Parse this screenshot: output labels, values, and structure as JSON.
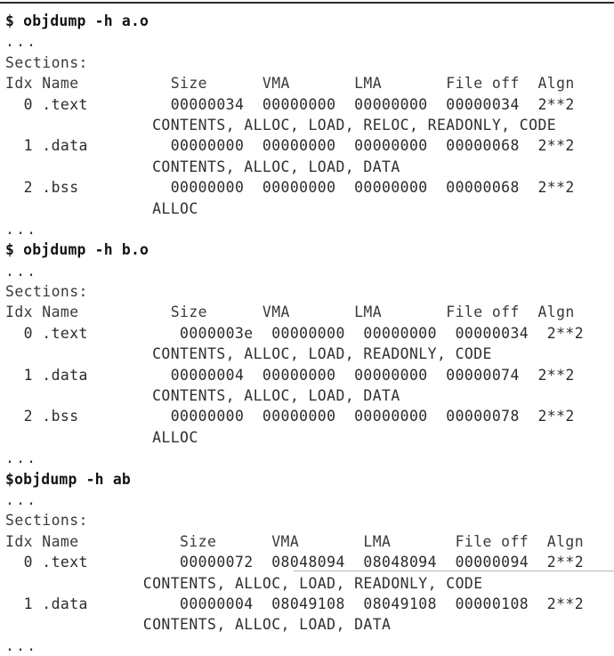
{
  "figure": {
    "kind": "terminal-transcript",
    "description": "objdump -h section header listings for a.o, b.o and linked executable ab",
    "ellipsis": "...",
    "text_color": "#2b2b2b",
    "background_color": "#ffffff",
    "rule_color": "#2a2a2a"
  },
  "columns": {
    "idx": "Idx",
    "name": "Name",
    "size": "Size",
    "vma": "VMA",
    "lma": "LMA",
    "file_off": "File off",
    "algn": "Algn",
    "header_line": "Idx Name          Size      VMA       LMA       File off  Algn",
    "sections_label": "Sections:"
  },
  "blocks": [
    {
      "id": "a-o",
      "command": "$ objdump -h a.o",
      "lead_ellipsis": null,
      "sections_label": "Sections:",
      "header_line": "Idx Name          Size      VMA       LMA       File off  Algn",
      "rows": [
        {
          "idx": "0",
          "name": ".text",
          "size": "00000034",
          "vma": "00000000",
          "lma": "00000000",
          "file_off": "00000034",
          "algn": "2**2",
          "row_line": "  0 .text         00000034  00000000  00000000  00000034  2**2",
          "flags": "CONTENTS, ALLOC, LOAD, RELOC, READONLY, CODE",
          "flags_line": "                CONTENTS, ALLOC, LOAD, RELOC, READONLY, CODE"
        },
        {
          "idx": "1",
          "name": ".data",
          "size": "00000000",
          "vma": "00000000",
          "lma": "00000000",
          "file_off": "00000068",
          "algn": "2**2",
          "row_line": "  1 .data         00000000  00000000  00000000  00000068  2**2",
          "flags": "CONTENTS, ALLOC, LOAD, DATA",
          "flags_line": "                CONTENTS, ALLOC, LOAD, DATA"
        },
        {
          "idx": "2",
          "name": ".bss",
          "size": "00000000",
          "vma": "00000000",
          "lma": "00000000",
          "file_off": "00000068",
          "algn": "2**2",
          "row_line": "  2 .bss          00000000  00000000  00000000  00000068  2**2",
          "flags": "ALLOC",
          "flags_line": "                ALLOC"
        }
      ],
      "trail_ellipsis": "..."
    },
    {
      "id": "b-o",
      "command": "$ objdump -h b.o",
      "lead_ellipsis": "...",
      "sections_label": "Sections:",
      "header_line": "Idx Name          Size      VMA       LMA       File off  Algn",
      "rows": [
        {
          "idx": "0",
          "name": ".text",
          "size": "0000003e",
          "vma": "00000000",
          "lma": "00000000",
          "file_off": "00000034",
          "algn": "2**2",
          "row_line": "  0 .text          0000003e  00000000  00000000  00000034  2**2",
          "flags": "CONTENTS, ALLOC, LOAD, READONLY, CODE",
          "flags_line": "                CONTENTS, ALLOC, LOAD, READONLY, CODE"
        },
        {
          "idx": "1",
          "name": ".data",
          "size": "00000004",
          "vma": "00000000",
          "lma": "00000000",
          "file_off": "00000074",
          "algn": "2**2",
          "row_line": "  1 .data         00000004  00000000  00000000  00000074  2**2",
          "flags": "CONTENTS, ALLOC, LOAD, DATA",
          "flags_line": "                CONTENTS, ALLOC, LOAD, DATA"
        },
        {
          "idx": "2",
          "name": ".bss",
          "size": "00000000",
          "vma": "00000000",
          "lma": "00000000",
          "file_off": "00000078",
          "algn": "2**2",
          "row_line": "  2 .bss          00000000  00000000  00000000  00000078  2**2",
          "flags": "ALLOC",
          "flags_line": "                ALLOC"
        }
      ],
      "trail_ellipsis": "..."
    },
    {
      "id": "ab",
      "command": "$objdump -h ab",
      "lead_ellipsis": "...",
      "sections_label": "Sections:",
      "header_line": "Idx Name           Size      VMA       LMA       File off  Algn",
      "rows": [
        {
          "idx": "0",
          "name": ".text",
          "size": "00000072",
          "vma": "08048094",
          "lma": "08048094",
          "file_off": "00000094",
          "algn": "2**2",
          "row_line": "  0 .text          00000072  08048094  08048094  00000094  2**2",
          "flags": "CONTENTS, ALLOC, LOAD, READONLY, CODE",
          "flags_line": "                CONTENTS, ALLOC, LOAD, READONLY, CODE"
        },
        {
          "idx": "1",
          "name": ".data",
          "size": "00000004",
          "vma": "08049108",
          "lma": "08049108",
          "file_off": "00000108",
          "algn": "2**2",
          "row_line": "  1 .data          00000004  08049108  08049108  00000108  2**2",
          "flags": "CONTENTS, ALLOC, LOAD, DATA",
          "flags_line": "                CONTENTS, ALLOC, LOAD, DATA"
        }
      ],
      "trail_ellipsis": "..."
    }
  ],
  "rendered_lines": [
    {
      "key": "l01",
      "text": "$ objdump -h a.o",
      "style": "cmd"
    },
    {
      "key": "l02",
      "text": "...",
      "style": "ellipsis"
    },
    {
      "key": "l03",
      "text": "Sections:",
      "style": "label"
    },
    {
      "key": "l04",
      "text": "Idx Name          Size      VMA       LMA       File off  Algn",
      "style": "header"
    },
    {
      "key": "l05",
      "text": "  0 .text         00000034  00000000  00000000  00000034  2**2",
      "style": "row"
    },
    {
      "key": "l06",
      "text": "                CONTENTS, ALLOC, LOAD, RELOC, READONLY, CODE",
      "style": "flags"
    },
    {
      "key": "l07",
      "text": "  1 .data         00000000  00000000  00000000  00000068  2**2",
      "style": "row"
    },
    {
      "key": "l08",
      "text": "                CONTENTS, ALLOC, LOAD, DATA",
      "style": "flags"
    },
    {
      "key": "l09",
      "text": "  2 .bss          00000000  00000000  00000000  00000068  2**2",
      "style": "row"
    },
    {
      "key": "l10",
      "text": "                ALLOC",
      "style": "flags"
    },
    {
      "key": "l11",
      "text": "...",
      "style": "ellipsis"
    },
    {
      "key": "l12",
      "text": "$ objdump -h b.o",
      "style": "cmd"
    },
    {
      "key": "l13",
      "text": "...",
      "style": "ellipsis"
    },
    {
      "key": "l14",
      "text": "Sections:",
      "style": "label"
    },
    {
      "key": "l15",
      "text": "Idx Name          Size      VMA       LMA       File off  Algn",
      "style": "header"
    },
    {
      "key": "l16",
      "text": "  0 .text          0000003e  00000000  00000000  00000034  2**2",
      "style": "row"
    },
    {
      "key": "l17",
      "text": "                CONTENTS, ALLOC, LOAD, READONLY, CODE",
      "style": "flags"
    },
    {
      "key": "l18",
      "text": "  1 .data         00000004  00000000  00000000  00000074  2**2",
      "style": "row"
    },
    {
      "key": "l19",
      "text": "                CONTENTS, ALLOC, LOAD, DATA",
      "style": "flags"
    },
    {
      "key": "l20",
      "text": "  2 .bss          00000000  00000000  00000000  00000078  2**2",
      "style": "row"
    },
    {
      "key": "l21",
      "text": "                ALLOC",
      "style": "flags"
    },
    {
      "key": "l22",
      "text": "...",
      "style": "ellipsis"
    },
    {
      "key": "l23",
      "text": "$objdump -h ab",
      "style": "cmd"
    },
    {
      "key": "l24",
      "text": "...",
      "style": "ellipsis"
    },
    {
      "key": "l25",
      "text": "Sections:",
      "style": "label"
    },
    {
      "key": "l26",
      "text": "Idx Name           Size      VMA       LMA       File off  Algn",
      "style": "header"
    },
    {
      "key": "l27",
      "text": "  0 .text          00000072  08048094  08048094  00000094  2**2",
      "style": "row"
    },
    {
      "key": "l28",
      "text": "               CONTENTS, ALLOC, LOAD, READONLY, CODE",
      "style": "flags"
    },
    {
      "key": "l29",
      "text": "  1 .data          00000004  08049108  08049108  00000108  2**2",
      "style": "row"
    },
    {
      "key": "l30",
      "text": "               CONTENTS, ALLOC, LOAD, DATA",
      "style": "flags"
    },
    {
      "key": "l31",
      "text": "...",
      "style": "ellipsis"
    }
  ]
}
